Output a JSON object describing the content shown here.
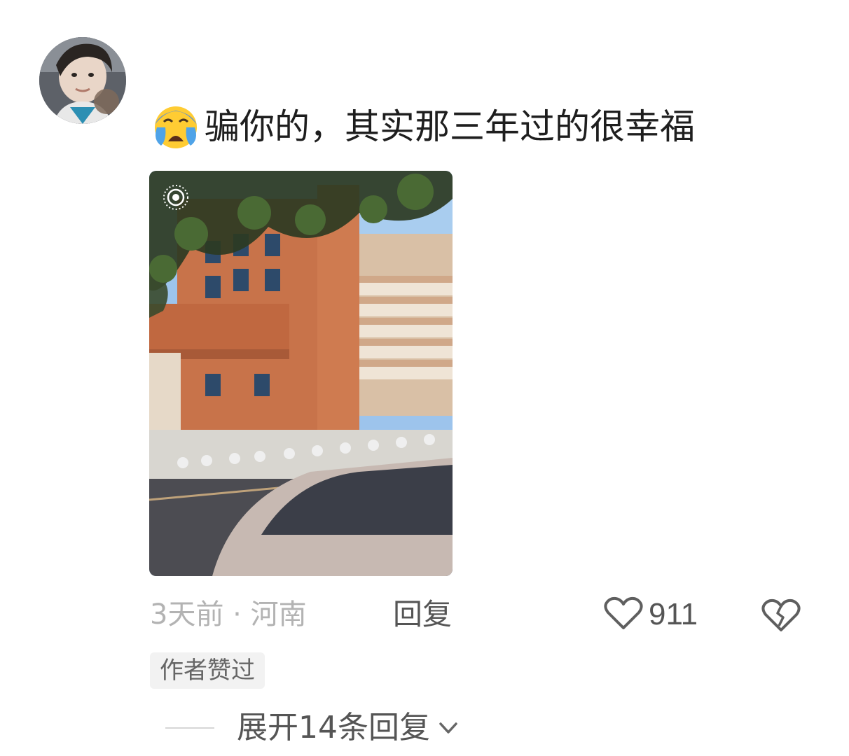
{
  "comment": {
    "text": "骗你的，其实那三年过的很幸福",
    "emoji_icon": "loudly-crying-face-icon",
    "has_photo": true,
    "photo_live_icon": "live-photo-icon"
  },
  "meta": {
    "time_location": "3天前 · 河南",
    "reply_label": "回复",
    "like_count": "911",
    "like_icon": "heart-outline-icon",
    "dislike_icon": "broken-heart-icon"
  },
  "badge": {
    "label": "作者赞过"
  },
  "replies": {
    "expand_label": "展开14条回复",
    "chevron_icon": "chevron-down-icon"
  },
  "colors": {
    "secondary_text": "#b3b3b3",
    "action_text": "#555555",
    "badge_bg": "#f2f2f2"
  }
}
